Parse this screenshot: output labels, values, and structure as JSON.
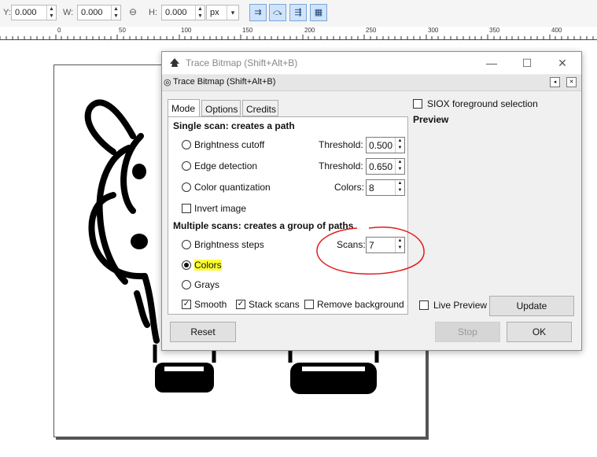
{
  "toolbar": {
    "y_label": "Y:",
    "y_value": "0.000",
    "w_label": "W:",
    "w_value": "0.000",
    "h_label": "H:",
    "h_value": "0.000",
    "unit": "px"
  },
  "ruler": {
    "ticks": [
      "0",
      "50",
      "100",
      "150",
      "200",
      "250",
      "300",
      "350",
      "400"
    ]
  },
  "dialog": {
    "window_title": "Trace Bitmap (Shift+Alt+B)",
    "panel_title": "Trace Bitmap (Shift+Alt+B)",
    "tabs": [
      "Mode",
      "Options",
      "Credits"
    ],
    "single_scan_header": "Single scan: creates a path",
    "brightness_cutoff": "Brightness cutoff",
    "edge_detection": "Edge detection",
    "color_quantization": "Color quantization",
    "threshold_label": "Threshold:",
    "threshold_brightness": "0.500",
    "threshold_edge": "0.650",
    "colors_label": "Colors:",
    "colors_value": "8",
    "invert_image": "Invert image",
    "multiple_scans_header": "Multiple scans: creates a group of paths",
    "brightness_steps": "Brightness steps",
    "colors_option": "Colors",
    "grays": "Grays",
    "scans_label": "Scans:",
    "scans_value": "7",
    "smooth": "Smooth",
    "stack_scans": "Stack scans",
    "remove_background": "Remove background",
    "siox": "SIOX foreground selection",
    "preview": "Preview",
    "live_preview": "Live Preview",
    "update": "Update",
    "reset": "Reset",
    "stop": "Stop",
    "ok": "OK"
  }
}
